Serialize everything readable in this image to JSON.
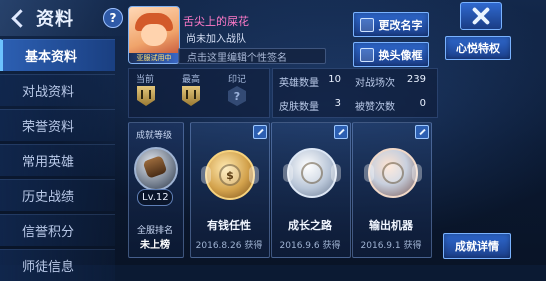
{
  "header": {
    "title": "资料",
    "help_label": "?"
  },
  "sidebar": {
    "items": [
      {
        "label": "基本资料",
        "active": true
      },
      {
        "label": "对战资料",
        "active": false
      },
      {
        "label": "荣誉资料",
        "active": false
      },
      {
        "label": "常用英雄",
        "active": false
      },
      {
        "label": "历史战绩",
        "active": false
      },
      {
        "label": "信誉积分",
        "active": false
      },
      {
        "label": "师徒信息",
        "active": false
      }
    ]
  },
  "profile": {
    "name": "舌尖上的屎花",
    "team": "尚未加入战队",
    "signature_placeholder": "点击这里编辑个性签名",
    "avatar_badge": "亚服试用中"
  },
  "buttons": {
    "rename": "更改名字",
    "change_frame": "换头像框",
    "privilege": "心悦特权",
    "detail": "成就详情"
  },
  "ranks": {
    "current_label": "当前",
    "highest_label": "最高",
    "mark_label": "印记",
    "mark_value": "?"
  },
  "stats": {
    "hero_count_label": "英雄数量",
    "hero_count": "10",
    "matches_label": "对战场次",
    "matches": "239",
    "skin_count_label": "皮肤数量",
    "skin_count": "3",
    "likes_label": "被赞次数",
    "likes": "0"
  },
  "level": {
    "title": "成就等级",
    "value": "Lv.12",
    "rank_label": "全服排名",
    "rank_value": "未上榜"
  },
  "medals": [
    {
      "name": "有钱任性",
      "date": "2016.8.26 获得",
      "symbol": "$"
    },
    {
      "name": "成长之路",
      "date": "2016.9.6 获得",
      "symbol": ""
    },
    {
      "name": "输出机器",
      "date": "2016.9.1 获得",
      "symbol": ""
    }
  ],
  "colors": {
    "accent_blue": "#2c5fb2",
    "name_pink": "#ff7ac8",
    "background": "#0b1a33"
  }
}
